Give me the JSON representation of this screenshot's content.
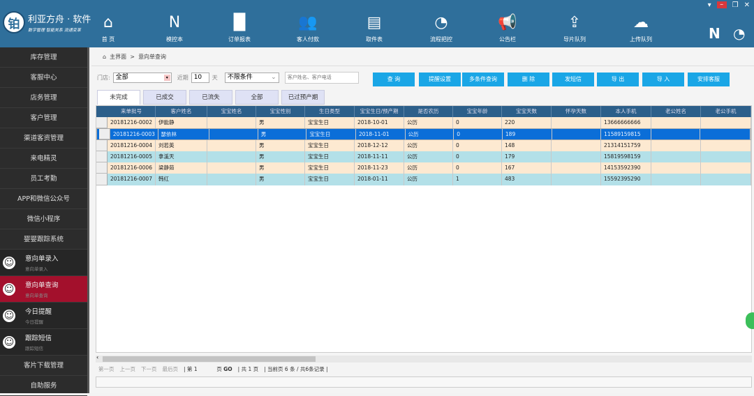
{
  "app": {
    "logo_char": "铂",
    "title": "利亚方舟 · 软件",
    "slogan": "数字管理  智能关系  流通变革"
  },
  "nav": [
    {
      "label": "首 页",
      "icon": "home-icon",
      "glyph": "⌂"
    },
    {
      "label": "模控本",
      "icon": "notebook-icon",
      "glyph": "N"
    },
    {
      "label": "订单报表",
      "icon": "bar-chart-icon",
      "glyph": "▐▌"
    },
    {
      "label": "客人付款",
      "icon": "users-icon",
      "glyph": "👥"
    },
    {
      "label": "取件表",
      "icon": "cabinet-icon",
      "glyph": "▤"
    },
    {
      "label": "流程把控",
      "icon": "signal-icon",
      "glyph": "◔"
    },
    {
      "label": "公告栏",
      "icon": "megaphone-icon",
      "glyph": "📢"
    },
    {
      "label": "导片队列",
      "icon": "upload-window-icon",
      "glyph": "⇪"
    },
    {
      "label": "上传队列",
      "icon": "cloud-upload-icon",
      "glyph": "☁"
    }
  ],
  "sidebar": {
    "items": [
      "库存管理",
      "客服中心",
      "店务管理",
      "客户管理",
      "渠道客资管理",
      "来电精灵",
      "员工考勤",
      "APP和微信公众号",
      "微信小程序",
      "婴婴跟踪系统"
    ],
    "subitems": [
      {
        "title": "意向单录入",
        "sub": "意向单录入"
      },
      {
        "title": "意向单查询",
        "sub": "意向单查询"
      },
      {
        "title": "今日提醒",
        "sub": "今日提醒"
      },
      {
        "title": "跟踪短信",
        "sub": "跟踪短信"
      }
    ],
    "bottom": [
      "客片下载管理",
      "自助服务"
    ]
  },
  "breadcrumb": {
    "home": "主界面",
    "sep": ">",
    "current": "意向单查询"
  },
  "filters": {
    "store_label": "门店:",
    "store_value": "全部",
    "recent_label": "近期",
    "days": "10",
    "days_unit": "天",
    "condition": "不限条件",
    "search_placeholder": "客户姓名、客户电话"
  },
  "buttons": [
    "查 询",
    "提醒设置",
    "多条件查询",
    "删 除",
    "发短信",
    "导 出",
    "导 入",
    "安排客服"
  ],
  "tabs": [
    "未完成",
    "已成交",
    "已流失",
    "全部",
    "已过预产期"
  ],
  "table": {
    "columns": [
      "来单批号",
      "客户姓名",
      "宝宝姓名",
      "宝宝性别",
      "生日类型",
      "宝宝生日/预产期",
      "是否农历",
      "宝宝年龄",
      "宝宝天数",
      "怀孕天数",
      "本人手机",
      "老公姓名",
      "老公手机"
    ],
    "rows": [
      [
        "20181216-0002",
        "伊能静",
        "",
        "男",
        "宝宝生日",
        "2018-10-01",
        "公历",
        "0",
        "220",
        "",
        "13666666666",
        "",
        ""
      ],
      [
        "20181216-0003",
        "瑟依林",
        "",
        "男",
        "宝宝生日",
        "2018-11-01",
        "公历",
        "0",
        "189",
        "",
        "11589159815",
        "",
        ""
      ],
      [
        "20181216-0004",
        "刘若英",
        "",
        "男",
        "宝宝生日",
        "2018-12-12",
        "公历",
        "0",
        "148",
        "",
        "21314151759",
        "",
        ""
      ],
      [
        "20181216-0005",
        "拿溪天",
        "",
        "男",
        "宝宝生日",
        "2018-11-11",
        "公历",
        "0",
        "179",
        "",
        "15819598159",
        "",
        ""
      ],
      [
        "20181216-0006",
        "梁静茹",
        "",
        "男",
        "宝宝生日",
        "2018-11-23",
        "公历",
        "0",
        "167",
        "",
        "14153592390",
        "",
        ""
      ],
      [
        "20181216-0007",
        "韩红",
        "",
        "男",
        "宝宝生日",
        "2018-01-11",
        "公历",
        "1",
        "483",
        "",
        "15592395290",
        "",
        ""
      ]
    ]
  },
  "pager": {
    "first": "第一页",
    "prev": "上一页",
    "next": "下一页",
    "last": "最后页",
    "page_prefix": "第",
    "page": "1",
    "page_suffix": "页",
    "go": "GO",
    "total_prefix": "共",
    "total_pages": "1",
    "total_suffix": "页",
    "current_info": "当前页  6  条  /  共6条记录"
  }
}
